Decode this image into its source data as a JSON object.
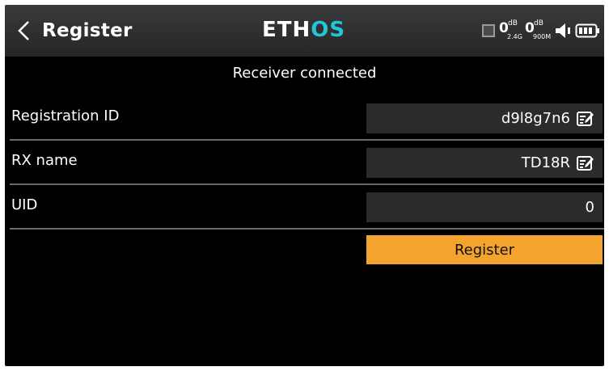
{
  "header": {
    "back_icon": "chevron-left-icon",
    "title": "Register",
    "logo_main": "ETH",
    "logo_accent": "OS",
    "logo_accent_color": "#21c7d9",
    "signal": [
      {
        "value": "0",
        "unit": "dB",
        "band": "2.4G"
      },
      {
        "value": "0",
        "unit": "dB",
        "band": "900M"
      }
    ],
    "icons": [
      "receiver-status-icon",
      "speaker-icon",
      "battery-icon"
    ]
  },
  "main": {
    "status_message": "Receiver connected",
    "fields": [
      {
        "label": "Registration ID",
        "value": "d9l8g7n6",
        "editable": true
      },
      {
        "label": "RX name",
        "value": "TD18R",
        "editable": true
      },
      {
        "label": "UID",
        "value": "0",
        "editable": false
      }
    ],
    "register_label": "Register",
    "register_color": "#f5a32f"
  }
}
